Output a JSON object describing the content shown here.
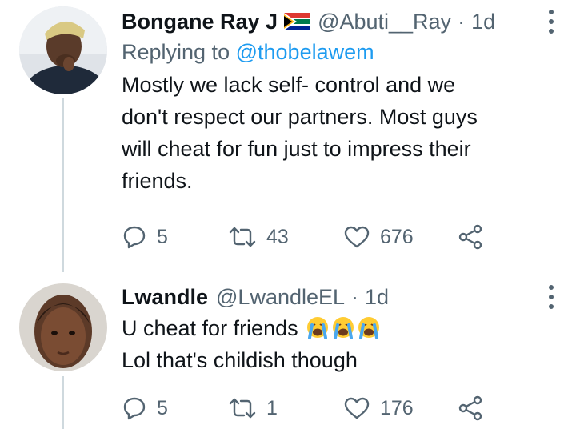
{
  "tweets": [
    {
      "display_name": "Bongane Ray J",
      "flag": "south-africa-flag",
      "handle": "@Abuti__Ray",
      "separator": "·",
      "time": "1d",
      "replying_prefix": "Replying to",
      "replying_to": "@thobelawem",
      "body_lines": [
        "Mostly we lack self- control and we",
        "don't respect our partners. Most guys",
        "will cheat for fun just to impress their",
        "friends."
      ],
      "replies": "5",
      "retweets": "43",
      "likes": "676"
    },
    {
      "display_name": "Lwandle",
      "handle": "@LwandleEL",
      "separator": "·",
      "time": "1d",
      "body_lines": [
        "U cheat for friends",
        "Lol that's childish though"
      ],
      "emojis": [
        "loudly-crying-face",
        "loudly-crying-face",
        "loudly-crying-face"
      ],
      "replies": "5",
      "retweets": "1",
      "likes": "176"
    }
  ],
  "colors": {
    "text": "#0f1419",
    "secondary": "#536471",
    "link": "#1d9bf0",
    "thread_line": "#cfd9de"
  }
}
